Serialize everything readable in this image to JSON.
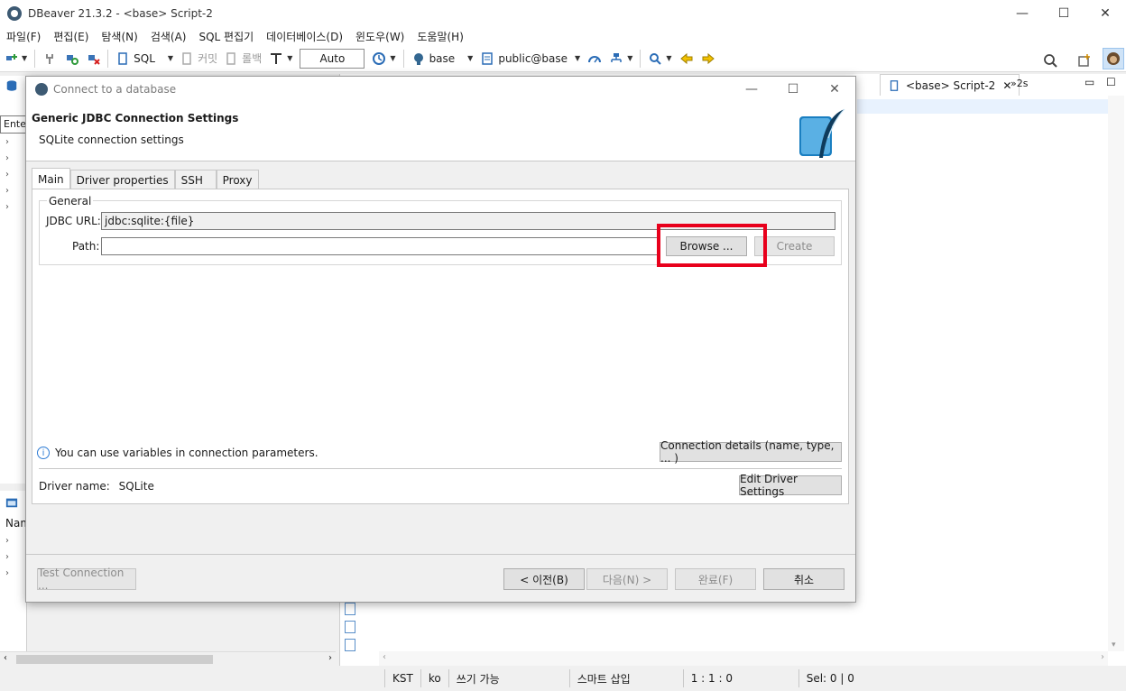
{
  "app": {
    "title": "DBeaver 21.3.2 - <base> Script-2",
    "window_controls": {
      "minimize": "—",
      "maximize": "☐",
      "close": "✕"
    }
  },
  "menu": [
    "파일(F)",
    "편집(E)",
    "탐색(N)",
    "검색(A)",
    "SQL 편집기",
    "데이터베이스(D)",
    "윈도우(W)",
    "도움말(H)"
  ],
  "toolbar": {
    "sql_label": "SQL",
    "commit_label": "커밋",
    "rollback_label": "롤백",
    "transaction_mode": "Auto",
    "datasource": "base",
    "schema": "public@base"
  },
  "left_panel": {
    "filter_placeholder": "Ente",
    "bottom_header": "Nam"
  },
  "editor": {
    "tab_label": "<base> Script-2",
    "overflow_label": "»2s",
    "hidden_tab_hint": "t"
  },
  "dialog": {
    "window_title": "Connect to a database",
    "header_title": "Generic JDBC Connection Settings",
    "header_subtitle": "SQLite connection settings",
    "tabs": [
      "Main",
      "Driver properties",
      "SSH",
      "Proxy"
    ],
    "group_label": "General",
    "jdbc_url_label": "JDBC URL:",
    "jdbc_url_value": "jdbc:sqlite:{file}",
    "path_label": "Path:",
    "path_value": "",
    "browse_label": "Browse ...",
    "create_label": "Create",
    "info_text": "You can use variables in connection parameters.",
    "connection_details_label": "Connection details (name, type, ... )",
    "driver_name_label": "Driver name:",
    "driver_name_value": "SQLite",
    "edit_driver_label": "Edit Driver Settings",
    "test_connection_label": "Test Connection ...",
    "back_label": "< 이전(B)",
    "next_label": "다음(N) >",
    "finish_label": "완료(F)",
    "cancel_label": "취소"
  },
  "statusbar": {
    "timezone": "KST",
    "locale": "ko",
    "write_mode": "쓰기 가능",
    "insert_mode": "스마트 삽입",
    "position": "1 : 1 : 0",
    "selection": "Sel: 0 | 0"
  },
  "colors": {
    "highlight_box": "#e8001c",
    "sqlite_blue": "#1a7fc1",
    "info_blue": "#2d7bd4"
  }
}
